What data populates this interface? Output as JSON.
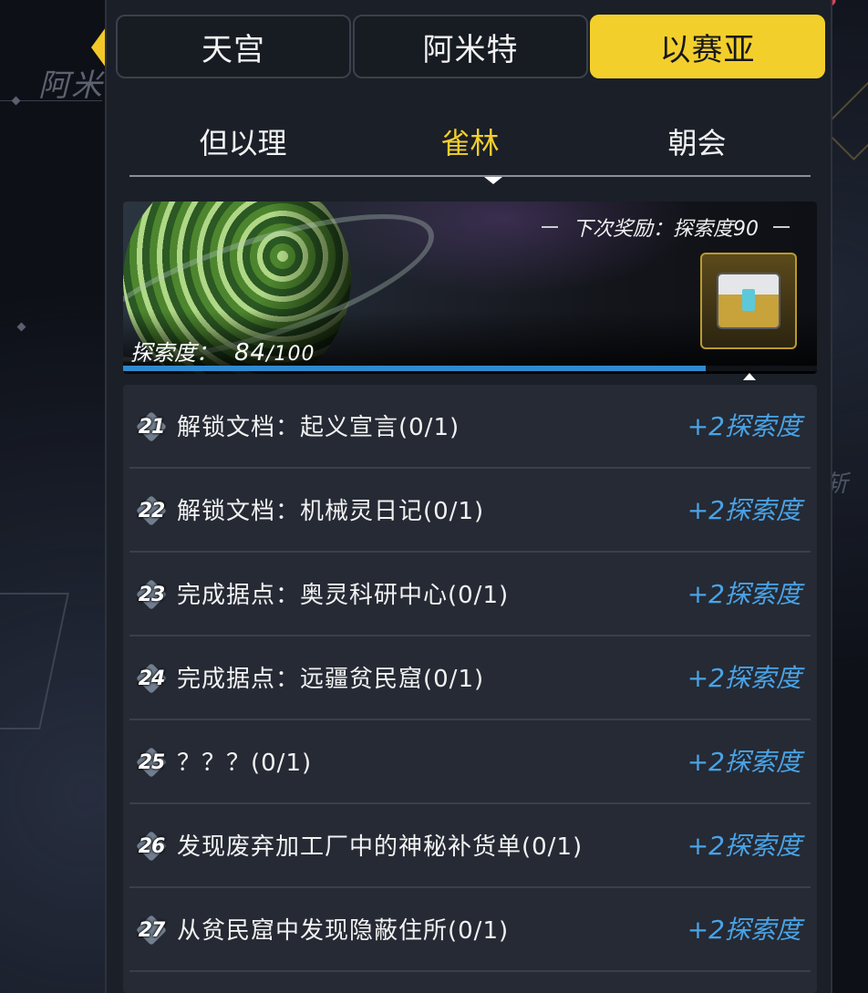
{
  "background": {
    "region_label": "阿米",
    "right_text": "斩"
  },
  "top_tabs": [
    {
      "label": "天宫",
      "active": false
    },
    {
      "label": "阿米特",
      "active": false
    },
    {
      "label": "以赛亚",
      "active": true
    }
  ],
  "sub_tabs": [
    {
      "label": "但以理",
      "active": false
    },
    {
      "label": "雀林",
      "active": true
    },
    {
      "label": "朝会",
      "active": false
    }
  ],
  "banner": {
    "next_reward": "下次奖励：探索度90",
    "progress_label": "探索度：",
    "progress_current": "84",
    "progress_total": "/100",
    "progress_fraction": 0.84
  },
  "tasks": [
    {
      "num": "21",
      "title": "解锁文档：起义宣言(0/1)",
      "reward": "+2探索度"
    },
    {
      "num": "22",
      "title": "解锁文档：机械灵日记(0/1)",
      "reward": "+2探索度"
    },
    {
      "num": "23",
      "title": "完成据点：奥灵科研中心(0/1)",
      "reward": "+2探索度"
    },
    {
      "num": "24",
      "title": "完成据点：远疆贫民窟(0/1)",
      "reward": "+2探索度"
    },
    {
      "num": "25",
      "title": "？？？(0/1)",
      "reward": "+2探索度"
    },
    {
      "num": "26",
      "title": "发现废弃加工厂中的神秘补货单(0/1)",
      "reward": "+2探索度"
    },
    {
      "num": "27",
      "title": "从贫民窟中发现隐蔽住所(0/1)",
      "reward": "+2探索度"
    }
  ],
  "colors": {
    "accent_yellow": "#f3cf2c",
    "reward_blue": "#4aa3e6",
    "progress_blue": "#2f8ad0"
  }
}
